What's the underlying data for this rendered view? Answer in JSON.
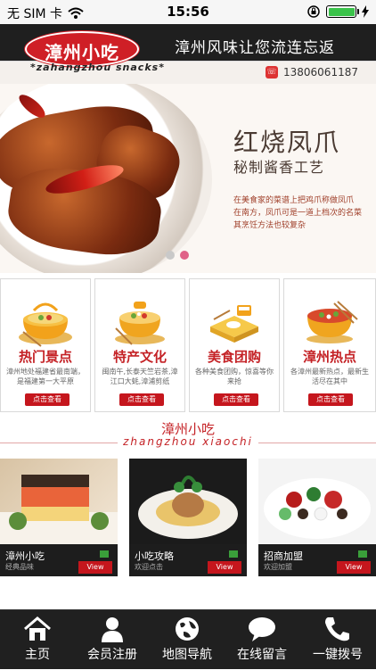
{
  "status_bar": {
    "carrier": "无 SIM 卡",
    "time": "15:56"
  },
  "header": {
    "logo_text": "漳州小吃",
    "tagline": "漳州风味让您流连忘返",
    "slogan": "zahangzhou snacks",
    "phone": "13806061187"
  },
  "banner": {
    "title": "红烧凤爪",
    "subtitle": "秘制酱香工艺",
    "description_lines": [
      "在美食家的菜谱上把鸡爪称做凤爪",
      "在南方，凤爪可是一道上档次的名菜",
      "其烹饪方法也较复杂"
    ],
    "active_slide": 2,
    "slide_count": 2
  },
  "categories": [
    {
      "label": "热门景点",
      "desc": "漳州地处福建省最南端，是福建第一大平原",
      "button": "点击查看"
    },
    {
      "label": "特产文化",
      "desc": "闽南午,长泰天竺岩茶,漳江口大蚝,漳浦剪纸",
      "button": "点击查看"
    },
    {
      "label": "美食团购",
      "desc": "各种美食团购，惊喜等你来抢",
      "button": "点击查看"
    },
    {
      "label": "漳州热点",
      "desc": "各漳州最新热点，最新生活尽在其中",
      "button": "点击查看"
    }
  ],
  "section": {
    "title": "漳州小吃",
    "subtitle": "zhangzhou xiaochi"
  },
  "tiles": [
    {
      "name": "漳州小吃",
      "small": "经典品味",
      "button": "View"
    },
    {
      "name": "小吃攻略",
      "small": "欢迎点击",
      "button": "View"
    },
    {
      "name": "招商加盟",
      "small": "欢迎加盟",
      "button": "View"
    }
  ],
  "tabbar": [
    {
      "label": "主页",
      "icon": "home-icon"
    },
    {
      "label": "会员注册",
      "icon": "user-icon"
    },
    {
      "label": "地图导航",
      "icon": "globe-icon"
    },
    {
      "label": "在线留言",
      "icon": "chat-bubble-icon"
    },
    {
      "label": "一键拨号",
      "icon": "phone-icon"
    }
  ],
  "colors": {
    "brand_red": "#c5161d",
    "header_bg": "#1f1f1f",
    "dot_active": "#e06288"
  }
}
